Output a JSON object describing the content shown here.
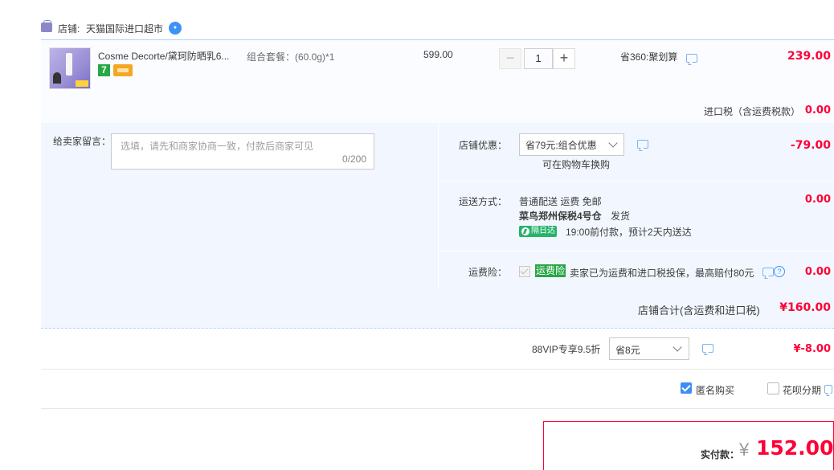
{
  "shop": {
    "label": "店铺:",
    "name": "天猫国际进口超市"
  },
  "item": {
    "title": "Cosme Decorte/黛珂防晒乳6...",
    "sku": "组合套餐：(60.0g)*1",
    "unit_price": "599.00",
    "quantity": "1",
    "promo": "省360:聚划算",
    "total": "239.00",
    "tag_seven": "7",
    "tax_label": "进口税（含运费税款）",
    "tax_value": "0.00"
  },
  "message": {
    "label": "给卖家留言：",
    "placeholder": "选填，请先和商家协商一致，付款后商家可见",
    "counter": "0/200"
  },
  "store_discount": {
    "label": "店铺优惠：",
    "selected": "省79元:组合优惠",
    "note": "可在购物车换购",
    "value": "-79.00"
  },
  "shipping": {
    "label": "运送方式：",
    "method": "普通配送 运费 免邮",
    "warehouse": "菜鸟郑州保税4号仓",
    "ship_text": "发货",
    "badge": "隔日达",
    "eta": "19:00前付款，预计2天内送达",
    "value": "0.00"
  },
  "insurance": {
    "label": "运费险：",
    "tag": "运费险",
    "text": "卖家已为运费和进口税投保，最高赔付80元",
    "help": "?",
    "value": "0.00"
  },
  "subtotal": {
    "label": "店铺合计(含运费和进口税)",
    "value": "¥160.00"
  },
  "vip": {
    "label": "88VIP专享9.5折",
    "selected": "省8元",
    "value": "¥-8.00"
  },
  "options": {
    "anonymous": "匿名购买",
    "anonymous_checked": true,
    "huabei": "花呗分期",
    "huabei_checked": false
  },
  "pay": {
    "label": "实付款：",
    "currency": "¥",
    "amount": "152.00"
  },
  "colors": {
    "price_red": "#ff0036",
    "accent_blue": "#3d8ef4",
    "panel_bg": "#f2f7ff",
    "tag_green": "#28a745"
  }
}
